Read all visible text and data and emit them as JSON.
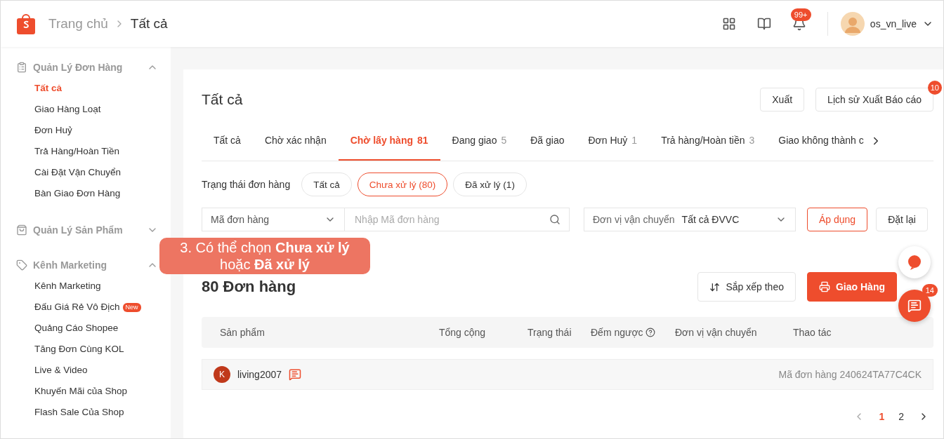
{
  "header": {
    "breadcrumb": [
      {
        "label": "Trang chủ",
        "current": false
      },
      {
        "label": "Tất cả",
        "current": true
      }
    ],
    "notification_badge": "99+",
    "username": "os_vn_live"
  },
  "sidebar": [
    {
      "title": "Quản Lý Đơn Hàng",
      "expanded": true,
      "items": [
        {
          "label": "Tất cả",
          "selected": true
        },
        {
          "label": "Giao Hàng Loạt",
          "selected": false
        },
        {
          "label": "Đơn Huỷ",
          "selected": false
        },
        {
          "label": "Trả Hàng/Hoàn Tiền",
          "selected": false
        },
        {
          "label": "Cài Đặt Vận Chuyển",
          "selected": false
        },
        {
          "label": "Bàn Giao Đơn Hàng",
          "selected": false
        }
      ]
    },
    {
      "title": "Quản Lý Sản Phẩm",
      "expanded": false
    },
    {
      "title": "Kênh Marketing",
      "expanded": true,
      "items": [
        {
          "label": "Kênh Marketing",
          "selected": false
        },
        {
          "label": "Đấu Giá Rẻ Vô Địch",
          "selected": false,
          "badge": "New"
        },
        {
          "label": "Quảng Cáo Shopee",
          "selected": false
        },
        {
          "label": "Tăng Đơn Cùng KOL",
          "selected": false
        },
        {
          "label": "Live & Video",
          "selected": false
        },
        {
          "label": "Khuyến Mãi của Shop",
          "selected": false
        },
        {
          "label": "Flash Sale Của Shop",
          "selected": false
        }
      ]
    }
  ],
  "page": {
    "title": "Tất cả",
    "export_button": "Xuất",
    "history_button": "Lịch sử Xuất Báo cáo",
    "history_badge": "10"
  },
  "tabs": [
    {
      "label": "Tất cả",
      "selected": false
    },
    {
      "label": "Chờ xác nhận",
      "selected": false
    },
    {
      "label": "Chờ lấy hàng",
      "count": "81",
      "selected": true
    },
    {
      "label": "Đang giao",
      "count": "5",
      "selected": false
    },
    {
      "label": "Đã giao",
      "selected": false
    },
    {
      "label": "Đơn Huỷ",
      "count": "1",
      "selected": false
    },
    {
      "label": "Trả hàng/Hoàn tiền",
      "count": "3",
      "selected": false
    },
    {
      "label": "Giao không thành c",
      "selected": false
    }
  ],
  "status_filter": {
    "label": "Trạng thái đơn hàng",
    "options": [
      {
        "label": "Tất cả",
        "selected": false
      },
      {
        "label": "Chưa xử lý (80)",
        "selected": true
      },
      {
        "label": "Đã xử lý (1)",
        "selected": false
      }
    ]
  },
  "search": {
    "field_select": "Mã đơn hàng",
    "placeholder": "Nhập Mã đơn hàng",
    "carrier_label": "Đơn vị vận chuyển",
    "carrier_value": "Tất cả ĐVVC",
    "apply": "Áp dụng",
    "reset": "Đặt lại"
  },
  "callout": "3. Có thể chọn **Chưa xử lý** hoặc **Đã xử lý**",
  "orders": {
    "count_title": "80 Đơn hàng",
    "sort_button": "Sắp xếp theo",
    "ship_button": "Giao Hàng",
    "columns": [
      "Sản phẩm",
      "Tổng cộng",
      "Trạng thái",
      "Đếm ngược",
      "Đơn vị vận chuyển",
      "Thao tác"
    ],
    "rows": [
      {
        "avatar": "K",
        "buyer": "living2007",
        "order_id": "Mã đơn hàng 240624TA77C4CK"
      }
    ]
  },
  "chat_badge": "14",
  "pagination": [
    {
      "label": "1",
      "selected": true
    },
    {
      "label": "2",
      "selected": false
    }
  ]
}
